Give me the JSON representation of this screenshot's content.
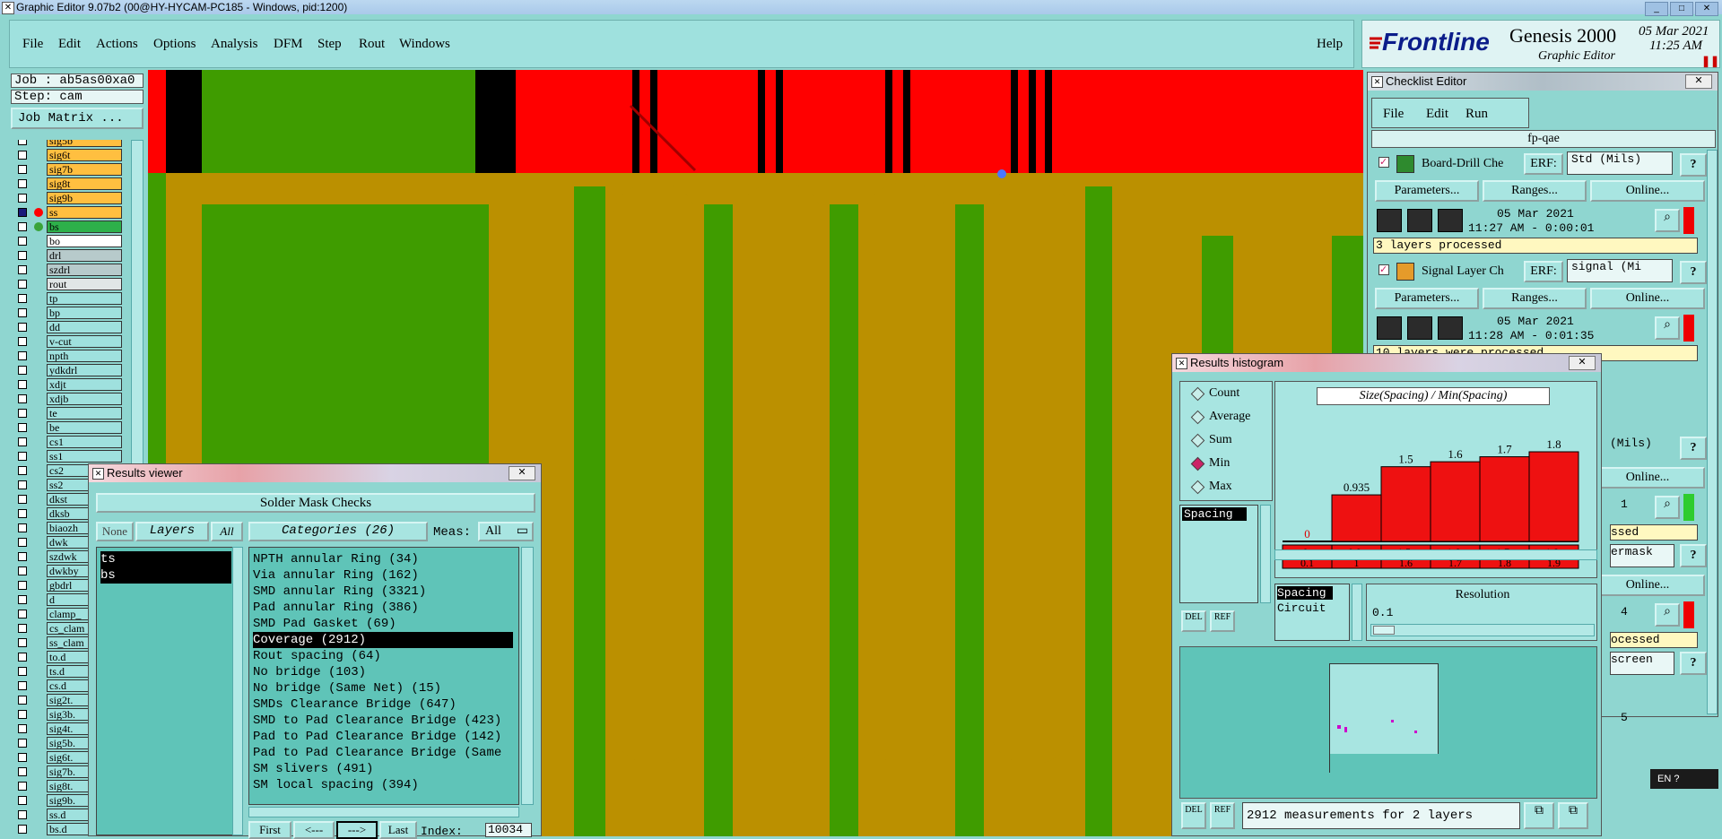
{
  "window": {
    "title": "Graphic Editor 9.07b2 (00@HY-HYCAM-PC185 - Windows, pid:1200)"
  },
  "menu": {
    "items": [
      "File",
      "Edit",
      "Actions",
      "Options",
      "Analysis",
      "DFM",
      "Step",
      "Rout",
      "Windows"
    ],
    "help": "Help"
  },
  "brand": {
    "logo": "Frontline",
    "product": "Genesis 2000",
    "subtitle": "Graphic Editor",
    "date": "05 Mar 2021",
    "time": "11:25 AM"
  },
  "job": {
    "job_line": "Job : ab5as00xa0",
    "step_line": "Step: cam",
    "matrix_button": "Job Matrix ..."
  },
  "layers": [
    {
      "name": "sig5b",
      "color": "#ffbf40"
    },
    {
      "name": "sig6t",
      "color": "#ffbf40"
    },
    {
      "name": "sig7b",
      "color": "#ffbf40"
    },
    {
      "name": "sig8t",
      "color": "#ffbf40"
    },
    {
      "name": "sig9b",
      "color": "#ffbf40"
    },
    {
      "name": "ss",
      "color": "#ffbf40",
      "active": true,
      "dot": "#ff0000"
    },
    {
      "name": "bs",
      "color": "#2db04a",
      "dot": "#3aa33a"
    },
    {
      "name": "bo",
      "color": "#ffffff"
    },
    {
      "name": "drl",
      "color": "#b7cacb"
    },
    {
      "name": "szdrl",
      "color": "#b7cacb"
    },
    {
      "name": "rout",
      "color": "#e0e6e6"
    },
    {
      "name": "tp",
      "color": "#9fe1de"
    },
    {
      "name": "bp",
      "color": "#9fe1de"
    },
    {
      "name": "dd",
      "color": "#9fe1de"
    },
    {
      "name": "v-cut",
      "color": "#9fe1de"
    },
    {
      "name": "npth",
      "color": "#9fe1de"
    },
    {
      "name": "ydkdrl",
      "color": "#9fe1de"
    },
    {
      "name": "xdjt",
      "color": "#9fe1de"
    },
    {
      "name": "xdjb",
      "color": "#9fe1de"
    },
    {
      "name": "te",
      "color": "#9fe1de"
    },
    {
      "name": "be",
      "color": "#9fe1de"
    },
    {
      "name": "cs1",
      "color": "#9fe1de"
    },
    {
      "name": "ss1",
      "color": "#9fe1de"
    },
    {
      "name": "cs2",
      "color": "#9fe1de"
    },
    {
      "name": "ss2",
      "color": "#9fe1de"
    },
    {
      "name": "dkst",
      "color": "#9fe1de"
    },
    {
      "name": "dksb",
      "color": "#9fe1de"
    },
    {
      "name": "biaozh",
      "color": "#9fe1de"
    },
    {
      "name": "dwk",
      "color": "#9fe1de"
    },
    {
      "name": "szdwk",
      "color": "#9fe1de"
    },
    {
      "name": "dwkby",
      "color": "#9fe1de"
    },
    {
      "name": "gbdrl",
      "color": "#9fe1de"
    },
    {
      "name": "d",
      "color": "#9fe1de"
    },
    {
      "name": "clamp_",
      "color": "#9fe1de"
    },
    {
      "name": "cs_clam",
      "color": "#9fe1de"
    },
    {
      "name": "ss_clam",
      "color": "#9fe1de"
    },
    {
      "name": "to.d",
      "color": "#9fe1de"
    },
    {
      "name": "ts.d",
      "color": "#9fe1de"
    },
    {
      "name": "cs.d",
      "color": "#9fe1de"
    },
    {
      "name": "sig2t.",
      "color": "#9fe1de"
    },
    {
      "name": "sig3b.",
      "color": "#9fe1de"
    },
    {
      "name": "sig4t.",
      "color": "#9fe1de"
    },
    {
      "name": "sig5b.",
      "color": "#9fe1de"
    },
    {
      "name": "sig6t.",
      "color": "#9fe1de"
    },
    {
      "name": "sig7b.",
      "color": "#9fe1de"
    },
    {
      "name": "sig8t.",
      "color": "#9fe1de"
    },
    {
      "name": "sig9b.",
      "color": "#9fe1de"
    },
    {
      "name": "ss.d",
      "color": "#9fe1de"
    },
    {
      "name": "bs.d",
      "color": "#9fe1de"
    }
  ],
  "results_viewer": {
    "title": "Results viewer",
    "heading": "Solder Mask Checks",
    "none_btn": "None",
    "layers_btn": "Layers",
    "all_btn": "All",
    "categories_btn": "Categories (26)",
    "meas_label": "Meas:",
    "meas_value": "All",
    "layer_items": [
      "ts",
      "bs"
    ],
    "categories": [
      "NPTH annular Ring (34)",
      "Via annular Ring (162)",
      "SMD annular Ring (3321)",
      "Pad annular Ring (386)",
      "SMD Pad Gasket (69)",
      "Coverage (2912)",
      "Rout spacing (64)",
      "No bridge (103)",
      "No bridge (Same Net) (15)",
      "SMDs Clearance Bridge (647)",
      "SMD to Pad Clearance Bridge (423)",
      "Pad to Pad Clearance Bridge (142)",
      "Pad to Pad Clearance Bridge (Same",
      "SM slivers (491)",
      "SM local spacing (394)"
    ],
    "selected_index": 5,
    "nav": {
      "first": "First",
      "prev": "<---",
      "next": "--->",
      "last": "Last",
      "index_label": "Index:",
      "index_value": "10034"
    }
  },
  "checklist": {
    "title": "Checklist Editor",
    "menu": [
      "File",
      "Edit",
      "Run"
    ],
    "name": "fp-qae",
    "erf_label": "ERF:",
    "params_btn": "Parameters...",
    "ranges_btn": "Ranges...",
    "online_btn": "Online...",
    "actions": [
      {
        "name": "Board-Drill Che",
        "erf": "Std (Mils)",
        "date": "05 Mar 2021",
        "time": "11:27 AM - 0:00:01",
        "status": "3 layers processed"
      },
      {
        "name": "Signal Layer Ch",
        "erf": "signal (Mi",
        "date": "05 Mar 2021",
        "time": "11:28 AM - 0:01:35",
        "status": "10 layers were processed"
      }
    ],
    "partial": [
      "(Mils)",
      "1",
      "ssed",
      "ermask",
      "4",
      "ocessed",
      "screen",
      "5",
      "ed"
    ]
  },
  "histogram": {
    "title": "Results histogram",
    "chart_title": "Size(Spacing) / Min(Spacing)",
    "modes": [
      "Count",
      "Average",
      "Sum",
      "Min",
      "Max"
    ],
    "selected_mode": "Min",
    "measure_list": [
      "Spacing"
    ],
    "measure_list2": [
      "Spacing",
      "Circuit"
    ],
    "resolution_label": "Resolution",
    "resolution_value": "0.1",
    "summary": "2912 measurements for 2 layers",
    "del_btn": "DEL",
    "ref_btn": "REF"
  },
  "chart_data": {
    "type": "bar",
    "title": "Size(Spacing) / Min(Spacing)",
    "categories": [
      "0-0.1",
      "0.9-1",
      "1.5-1.6",
      "1.6-1.7",
      "1.7-1.8",
      "1.8-1.9"
    ],
    "values": [
      0,
      0.935,
      1.5,
      1.6,
      1.7,
      1.8
    ],
    "value_labels": [
      "0",
      "0.935",
      "1.5",
      "1.6",
      "1.7",
      "1.8"
    ],
    "ylim": [
      0,
      1.8
    ],
    "color": "#ee1111"
  },
  "tray": {
    "lang": "EN"
  }
}
